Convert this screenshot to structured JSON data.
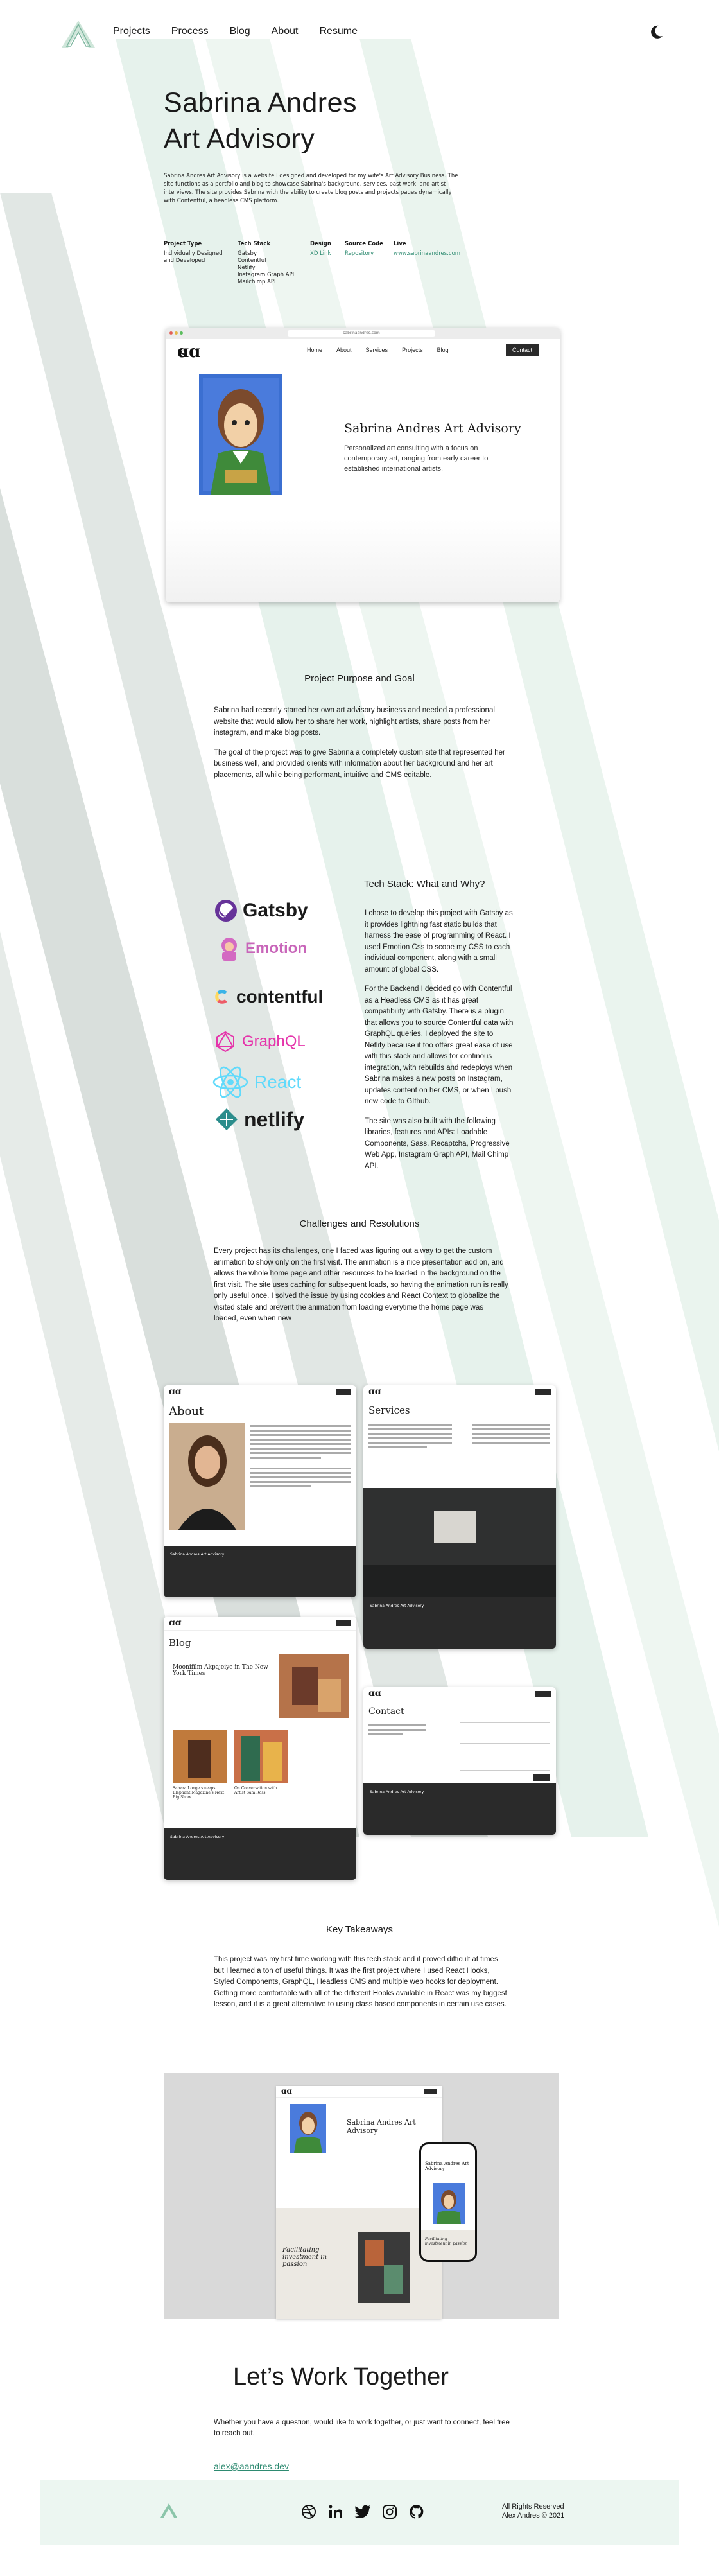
{
  "nav": {
    "items": [
      "Projects",
      "Process",
      "Blog",
      "About",
      "Resume"
    ]
  },
  "hero": {
    "title_line1": "Sabrina Andres",
    "title_line2": "Art Advisory",
    "intro": "Sabrina Andres Art Advisory is a website I designed and developed for my wife's Art Advisory Business. The site functions as a portfolio and blog to showcase Sabrina's background, services, past work, and artist interviews. The site provides Sabrina with the ability to create blog posts and projects pages dynamically with Contentful, a headless CMS platform."
  },
  "meta": {
    "project_type_label": "Project Type",
    "project_type_value": "Individually Designed and Developed",
    "tech_label": "Tech Stack",
    "tech_values": [
      "Gatsby",
      "Contentful",
      "Netlify",
      "Instagram Graph API",
      "Mailchimp API"
    ],
    "design_label": "Design",
    "design_value": "XD Link",
    "source_label": "Source Code",
    "source_value": "Repository",
    "live_label": "Live",
    "live_value": "www.sabrinaandres.com"
  },
  "site_preview": {
    "url": "sabrinaandres.com",
    "nav": [
      "Home",
      "About",
      "Services",
      "Projects",
      "Blog",
      "Contact"
    ],
    "heading": "Sabrina Andres Art Advisory",
    "subtext": "Personalized art consulting with a focus on contemporary art, ranging from early career to established international artists."
  },
  "purpose": {
    "title": "Project Purpose and Goal",
    "p1": "Sabrina had recently started her own art advisory business and needed a professional website that would allow her to share her work, highlight artists, share posts from her instagram, and make blog posts.",
    "p2": "The goal of the project was to give Sabrina a completely custom site that represented her business well, and provided clients with information about her background and her art placements,  all while being performant, intuitive and CMS editable."
  },
  "tech": {
    "title": "Tech Stack: What and Why?",
    "logos": [
      "Gatsby",
      "Emotion",
      "contentful",
      "GraphQL",
      "React",
      "netlify"
    ],
    "p1": "I chose to develop this project with Gatsby as it provides lightning fast static builds that harness the ease of programming of React. I used Emotion Css to scope my CSS to each individual component, along with a small amount of global CSS.",
    "p2": "For the Backend I decided go with Contentful as a Headless CMS as it has great compatibility with Gatsby. There is a plugin that allows you to source Contentful data with GraphQL queries. I deployed the site to Netlify because it too offers great ease of use with this stack and allows for continous integration, with rebuilds and redeploys when Sabrina makes a new posts on Instagram, updates content on her CMS, or when I push new code to GIthub.",
    "p3": "The site was also built with the following libraries, features and APIs: Loadable Components, Sass, Recaptcha,  Progressive Web App,  Instagram Graph API, Mail Chimp API."
  },
  "challenges": {
    "title": "Challenges and Resolutions",
    "p1": "Every project has its challenges, one I faced was figuring out a way to get the custom animation to show only on the first visit. The animation is a nice presentation add on, and allows the whole home page and other resources to be loaded in the background on the first visit. The site uses caching for subsequent loads, so having the animation run is really only useful once.  I solved the issue by using cookies and  React Context to globalize the visited state and prevent the animation from loading everytime the home page was loaded, even when new"
  },
  "gallery": {
    "about_title": "About",
    "services_title": "Services",
    "blog_title": "Blog",
    "contact_title": "Contact",
    "blog_post1": "Moonifilm Akpajeiye in The New York Times",
    "blog_post2": "Sahara Longe sweeps Elephant Magazine's Next Big Show",
    "blog_post3": "On Conversation with Artist Sam Ross",
    "footer_name": "Sabrina Andres Art Advisory"
  },
  "takeaways": {
    "title": "Key Takeaways",
    "p1": "This project was my first time working with this tech stack and it proved difficult at times but I learned a ton of useful things. It was the first project where I used React Hooks, Styled Components, GraphQL, Headless CMS and multiple web hooks for deployment. Getting more comfortable with all of the different Hooks available in React was my biggest lesson, and it is a great alternative to using class based components in certain use cases."
  },
  "mockup": {
    "heading": "Sabrina Andres Art Advisory",
    "card_title": "Facilitating investment in passion",
    "phone_title": "Sabrina Andres Art Advisory",
    "phone_card": "Facilitating investment in passion"
  },
  "contact": {
    "title": "Let’s Work Together",
    "text": "Whether you have a question, would like to work together, or just want to connect, feel free to reach out.",
    "email": "alex@aandres.dev"
  },
  "footer": {
    "copy_line1": "All Rights Reserved",
    "copy_line2": "Alex Andres © 2021"
  },
  "colors": {
    "accent": "#2e8b71",
    "stripe_green": "#e3f1e9",
    "stripe_grey": "#d6dcd9",
    "dark": "#2a2a2a"
  }
}
